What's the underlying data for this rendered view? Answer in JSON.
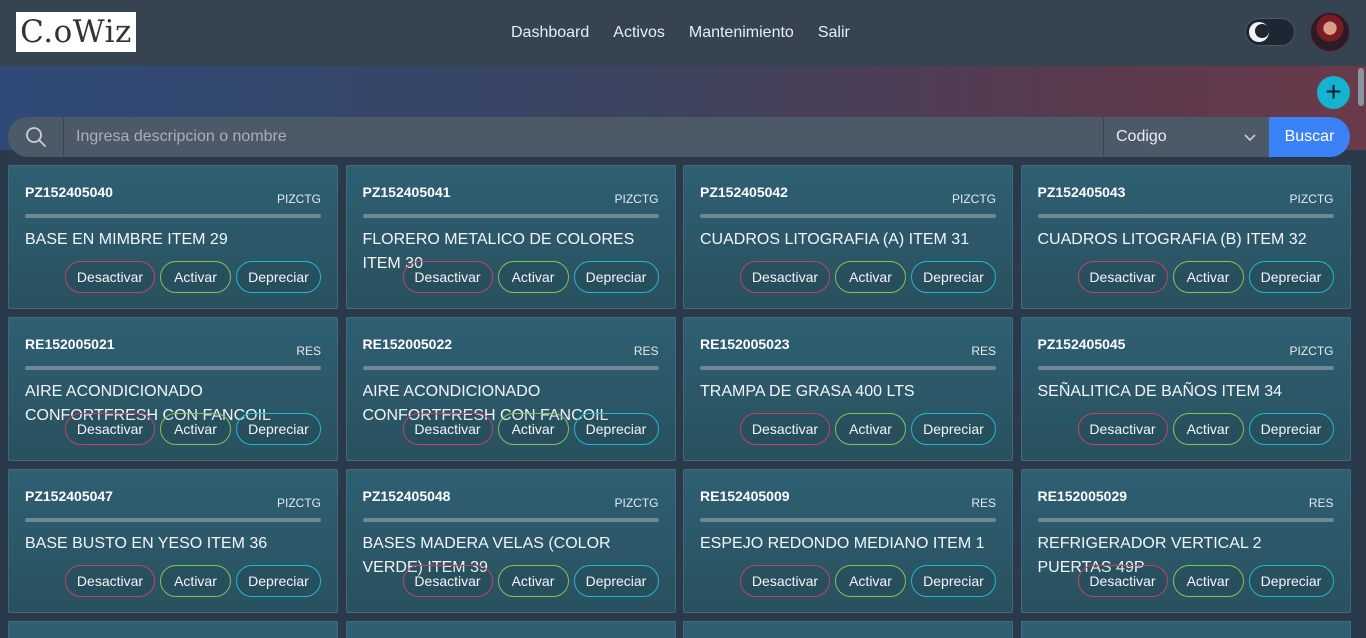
{
  "header": {
    "logo": "C.oWiz",
    "nav": [
      "Dashboard",
      "Activos",
      "Mantenimiento",
      "Salir"
    ]
  },
  "toolbar": {
    "add_label": "+"
  },
  "search": {
    "placeholder": "Ingresa descripcion o nombre",
    "value": "",
    "filter_selected": "Codigo",
    "button_label": "Buscar"
  },
  "actions": {
    "deactivate": "Desactivar",
    "activate": "Activar",
    "depreciate": "Depreciar"
  },
  "colors": {
    "accent": "#3b82f6",
    "add": "#14b3cf",
    "danger": "#c0445d",
    "success": "#7fc35a",
    "info": "#1fb7d1"
  },
  "cards": [
    {
      "code": "PZ152405040",
      "category": "PIZCTG",
      "description": "BASE EN MIMBRE ITEM 29"
    },
    {
      "code": "PZ152405041",
      "category": "PIZCTG",
      "description": "FLORERO METALICO DE COLORES ITEM 30"
    },
    {
      "code": "PZ152405042",
      "category": "PIZCTG",
      "description": "CUADROS LITOGRAFIA (A) ITEM 31"
    },
    {
      "code": "PZ152405043",
      "category": "PIZCTG",
      "description": "CUADROS LITOGRAFIA (B) ITEM 32"
    },
    {
      "code": "RE152005021",
      "category": "RES",
      "description": "AIRE ACONDICIONADO CONFORTFRESH CON FANCOIL"
    },
    {
      "code": "RE152005022",
      "category": "RES",
      "description": "AIRE ACONDICIONADO CONFORTFRESH CON FANCOIL"
    },
    {
      "code": "RE152005023",
      "category": "RES",
      "description": "TRAMPA DE GRASA 400 LTS"
    },
    {
      "code": "PZ152405045",
      "category": "PIZCTG",
      "description": "SEÑALITICA DE BAÑOS ITEM 34"
    },
    {
      "code": "PZ152405047",
      "category": "PIZCTG",
      "description": "BASE BUSTO EN YESO ITEM 36"
    },
    {
      "code": "PZ152405048",
      "category": "PIZCTG",
      "description": "BASES MADERA VELAS (COLOR VERDE) ITEM 39"
    },
    {
      "code": "RE152405009",
      "category": "RES",
      "description": "ESPEJO REDONDO MEDIANO ITEM 1"
    },
    {
      "code": "RE152005029",
      "category": "RES",
      "description": "REFRIGERADOR VERTICAL 2 PUERTAS 49P"
    }
  ]
}
